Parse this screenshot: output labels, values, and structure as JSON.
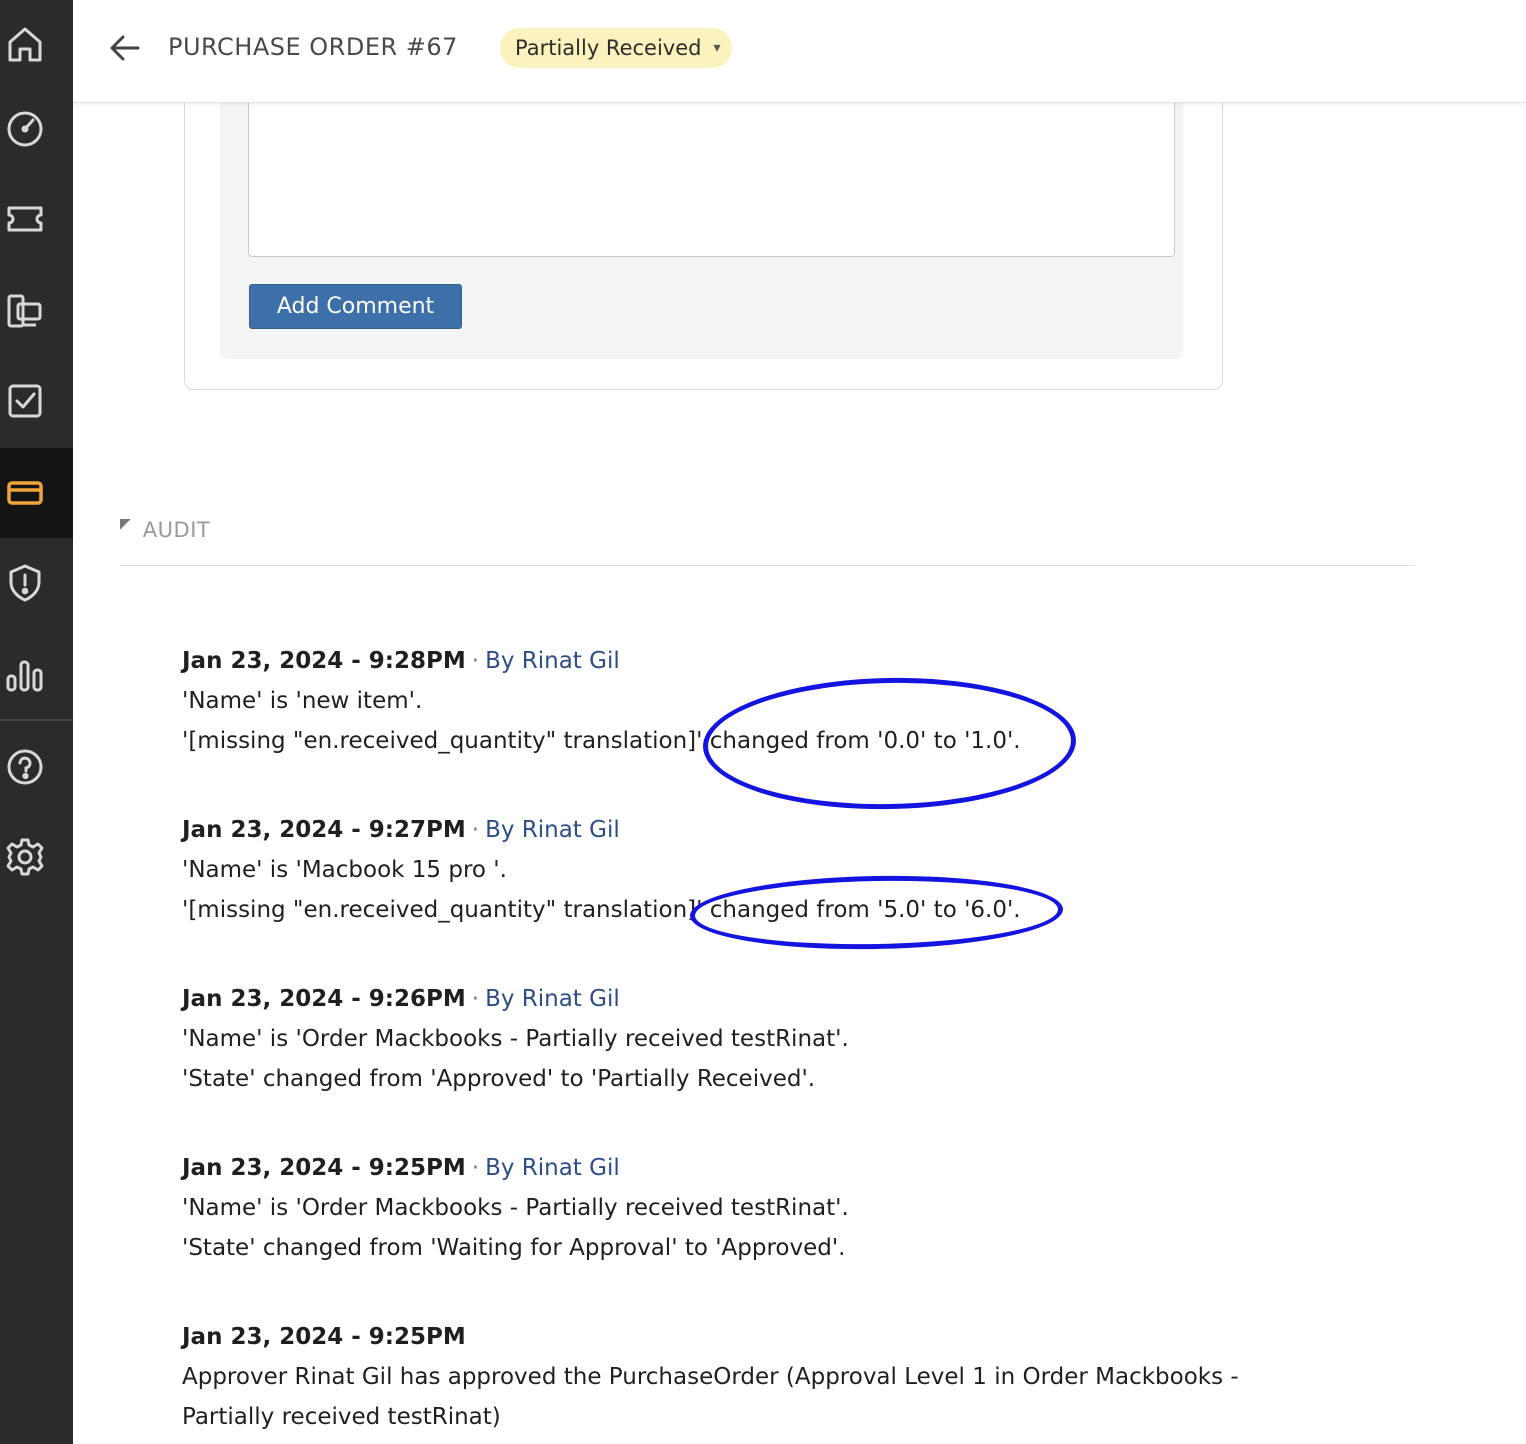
{
  "header": {
    "title": "PURCHASE ORDER #67",
    "status": "Partially Received",
    "status_caret": "▾"
  },
  "comment": {
    "button_label": "Add Comment"
  },
  "audit": {
    "title": "AUDIT",
    "entries": [
      {
        "timestamp": "Jan 23, 2024 - 9:28PM",
        "by": "By Rinat Gil",
        "lines": [
          "'Name' is 'new item'.",
          "'[missing \"en.received_quantity\" translation]' changed from '0.0' to '1.0'."
        ]
      },
      {
        "timestamp": "Jan 23, 2024 - 9:27PM",
        "by": "By Rinat Gil",
        "lines": [
          "'Name' is 'Macbook 15 pro '.",
          "'[missing \"en.received_quantity\" translation]' changed from '5.0' to '6.0'."
        ]
      },
      {
        "timestamp": "Jan 23, 2024 - 9:26PM",
        "by": "By Rinat Gil",
        "lines": [
          "'Name' is 'Order Mackbooks - Partially received testRinat'.",
          "'State' changed from 'Approved' to 'Partially Received'."
        ]
      },
      {
        "timestamp": "Jan 23, 2024 - 9:25PM",
        "by": "By Rinat Gil",
        "lines": [
          "'Name' is 'Order Mackbooks - Partially received testRinat'.",
          "'State' changed from 'Waiting for Approval' to 'Approved'."
        ]
      },
      {
        "timestamp": "Jan 23, 2024 - 9:25PM",
        "text": "Approver Rinat Gil has approved the PurchaseOrder (Approval Level 1 in Order Mackbooks - Partially received testRinat)"
      }
    ]
  },
  "annotation_color": "#1414e0",
  "sidebar": {
    "icons": [
      "home-icon",
      "dashboard-icon",
      "ticket-icon",
      "devices-icon",
      "tasks-icon",
      "purchase-icon",
      "security-icon",
      "reports-icon",
      "help-icon",
      "settings-icon"
    ],
    "active": "purchase-icon",
    "active_color": "#f0a53a"
  }
}
